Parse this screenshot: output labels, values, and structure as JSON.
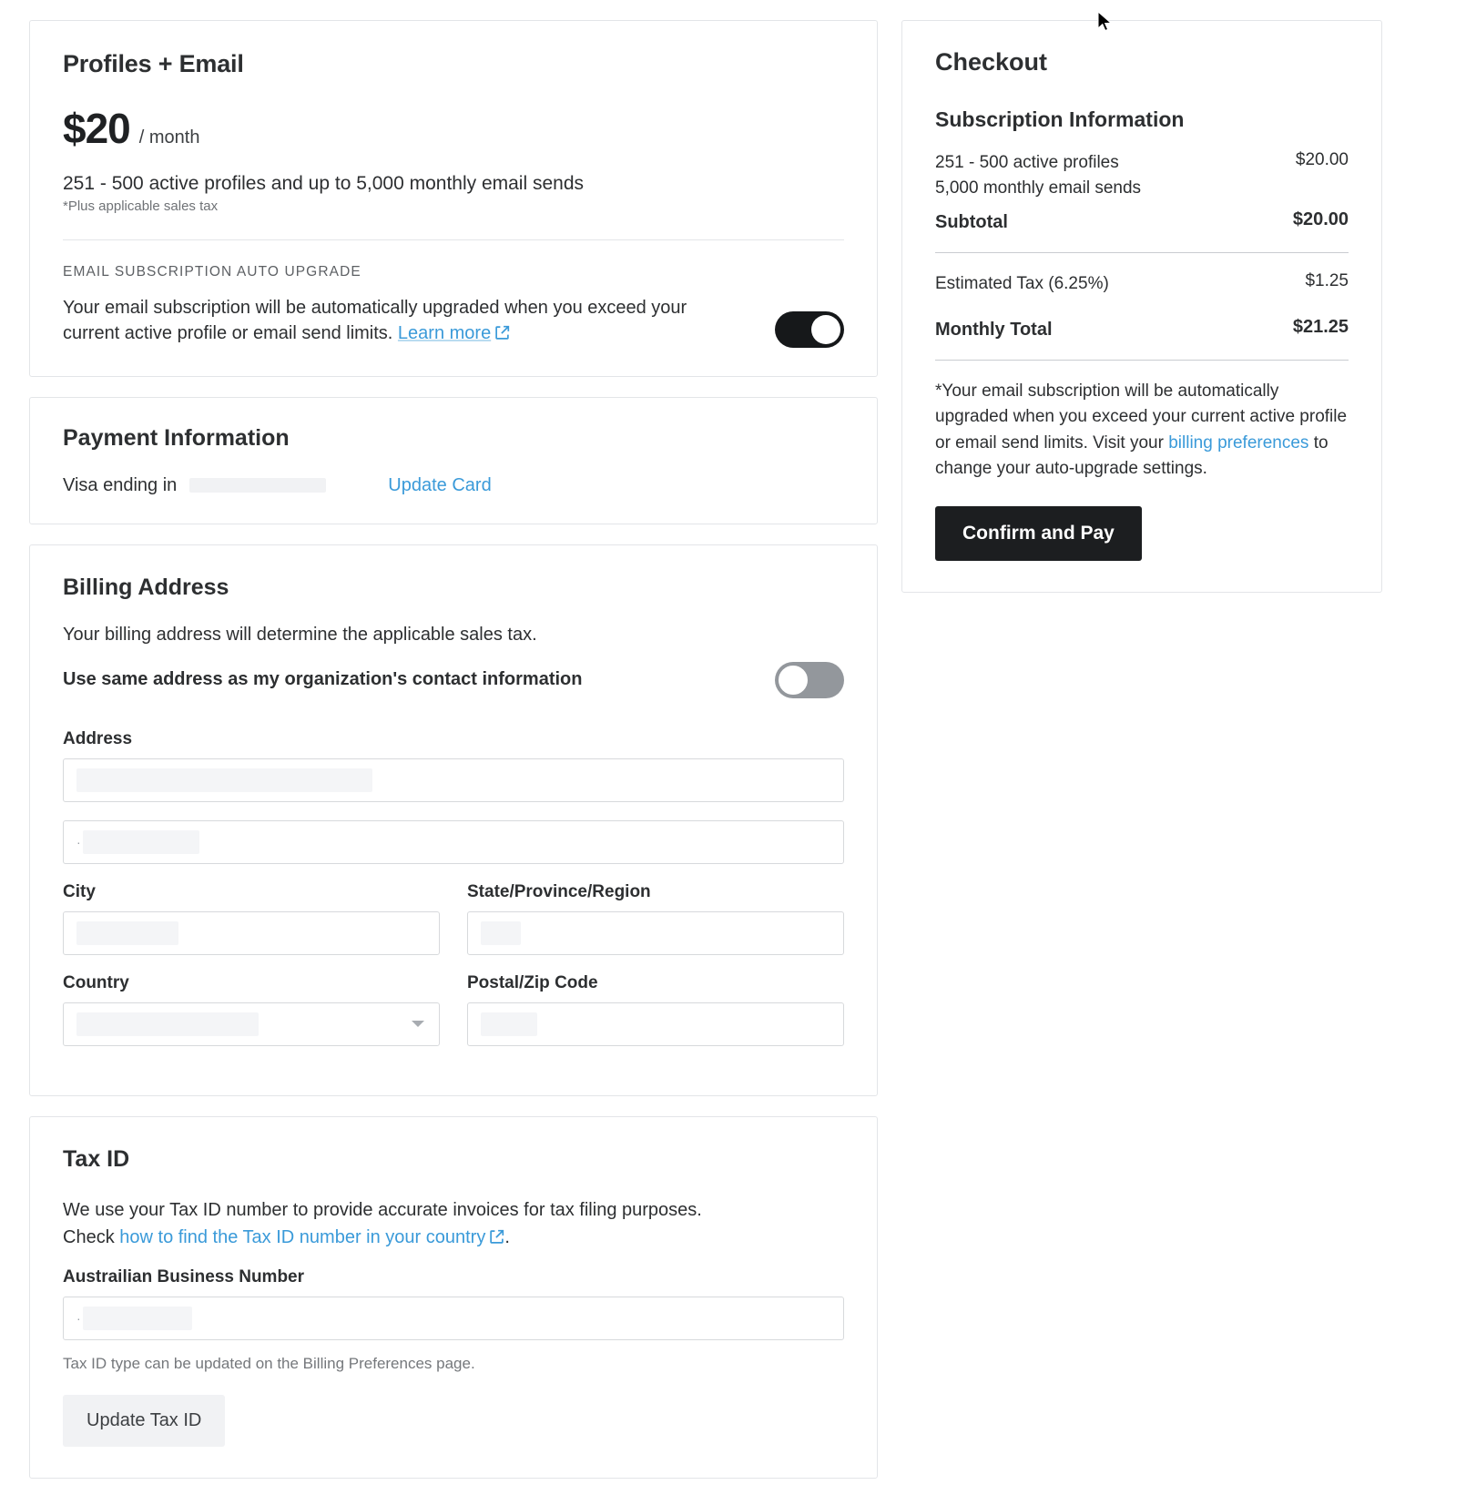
{
  "plan": {
    "title": "Profiles + Email",
    "price": "$20",
    "period": "/ month",
    "description": "251 - 500 active profiles and up to 5,000 monthly email sends",
    "tax_note": "*Plus applicable sales tax",
    "auto_upgrade_kicker": "EMAIL SUBSCRIPTION AUTO UPGRADE",
    "auto_upgrade_text": "Your email subscription will be automatically upgraded when you exceed your current active profile or email send limits.",
    "learn_more_label": "Learn more",
    "auto_upgrade_toggle_state": "on"
  },
  "payment": {
    "title": "Payment Information",
    "card_label": "Visa ending in",
    "card_digits": "",
    "update_label": "Update Card"
  },
  "billing_address": {
    "title": "Billing Address",
    "subtitle": "Your billing address will determine the applicable sales tax.",
    "same_address_label": "Use same address as my organization's contact information",
    "same_address_toggle_state": "off",
    "address_label": "Address",
    "address_line1_value": "",
    "address_line2_value": "",
    "city_label": "City",
    "city_value": "",
    "state_label": "State/Province/Region",
    "state_value": "",
    "country_label": "Country",
    "country_value": "",
    "postal_label": "Postal/Zip Code",
    "postal_value": ""
  },
  "tax_id": {
    "title": "Tax ID",
    "description": "We use your Tax ID number to provide accurate invoices for tax filing purposes.",
    "check_prefix": "Check",
    "link_label": "how to find the Tax ID number in your country",
    "check_suffix": ".",
    "field_label": "Austrailian Business Number",
    "field_value": "",
    "help_text": "Tax ID type can be updated on the Billing Preferences page.",
    "button_label": "Update Tax ID"
  },
  "checkout": {
    "title": "Checkout",
    "subscription_heading": "Subscription Information",
    "line_items": [
      {
        "label": "251 - 500 active profiles\n5,000 monthly email sends",
        "label_line1": "251 - 500 active profiles",
        "label_line2": "5,000 monthly email sends",
        "amount": "$20.00"
      }
    ],
    "subtotal_label": "Subtotal",
    "subtotal_amount": "$20.00",
    "tax_label": "Estimated Tax (6.25%)",
    "tax_amount": "$1.25",
    "total_label": "Monthly Total",
    "total_amount": "$21.25",
    "disclaimer_part1": "*Your email subscription will be automatically upgraded when you exceed your current active profile or email send limits. Visit your ",
    "disclaimer_link": "billing preferences",
    "disclaimer_part2": " to change your auto-upgrade settings.",
    "confirm_label": "Confirm and Pay"
  },
  "colors": {
    "link": "#3a9ad9",
    "primary_button": "#1c1e20",
    "toggle_on": "#16181a",
    "toggle_off": "#93979c"
  }
}
